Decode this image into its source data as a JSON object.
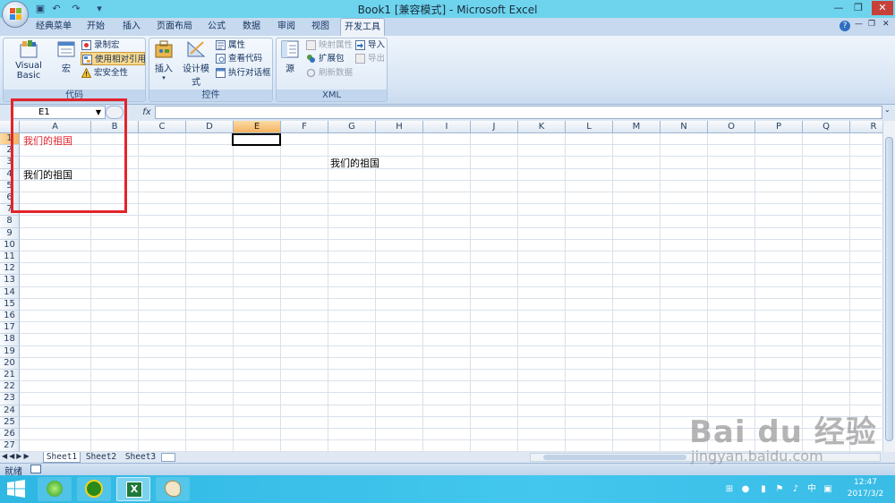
{
  "window": {
    "title": "Book1  [兼容模式] - Microsoft Excel",
    "minimize": "—",
    "restore": "❐",
    "close": "✕"
  },
  "quick_access": {
    "save": "▣",
    "undo": "↶",
    "redo": "↷",
    "more": "▾"
  },
  "ribbon_tabs": [
    "经典菜单",
    "开始",
    "插入",
    "页面布局",
    "公式",
    "数据",
    "审阅",
    "视图",
    "开发工具"
  ],
  "active_tab": "开发工具",
  "ribbon_right": {
    "help": "?",
    "minimize": "—",
    "restore": "❐",
    "close": "✕"
  },
  "ribbon": {
    "code": {
      "label": "代码",
      "visual_basic": "Visual Basic",
      "macros": "宏",
      "record_macro": "录制宏",
      "relative_ref": "使用相对引用",
      "macro_security": "宏安全性"
    },
    "controls": {
      "label": "控件",
      "insert": "插入",
      "design_mode": "设计模式",
      "properties": "属性",
      "view_code": "查看代码",
      "run_dialog": "执行对话框"
    },
    "xml": {
      "label": "XML",
      "source": "源",
      "map_properties": "映射属性",
      "expansion_packs": "扩展包",
      "refresh_data": "刷新数据",
      "import": "导入",
      "export": "导出"
    }
  },
  "formula_bar": {
    "name_box": "E1",
    "fx": "fx",
    "formula": ""
  },
  "columns": [
    "A",
    "B",
    "C",
    "D",
    "E",
    "F",
    "G",
    "H",
    "I",
    "J",
    "K",
    "L",
    "M",
    "N",
    "O",
    "P",
    "Q",
    "R"
  ],
  "selected_column": "E",
  "rows": [
    "1",
    "2",
    "3",
    "4",
    "5",
    "6",
    "7",
    "8",
    "9",
    "10",
    "11",
    "12",
    "13",
    "14",
    "15",
    "16",
    "17",
    "18",
    "19",
    "20",
    "21",
    "22",
    "23",
    "24",
    "25",
    "26",
    "27"
  ],
  "cells": {
    "A1": "我们的祖国",
    "A4": "我们的祖国",
    "G3": "我们的祖国"
  },
  "colors": {
    "red_text": "#e2242b",
    "annotation": "#e2242b",
    "selected_header": "#f5b260"
  },
  "sheet_tabs": [
    "Sheet1",
    "Sheet2",
    "Sheet3"
  ],
  "active_sheet": "Sheet1",
  "status": {
    "ready": "就绪"
  },
  "taskbar": {
    "time": "12:47",
    "date": "2017/3/2",
    "ime": "中"
  },
  "watermark": {
    "brand": "Bai du 经验",
    "url": "jingyan.baidu.com"
  }
}
